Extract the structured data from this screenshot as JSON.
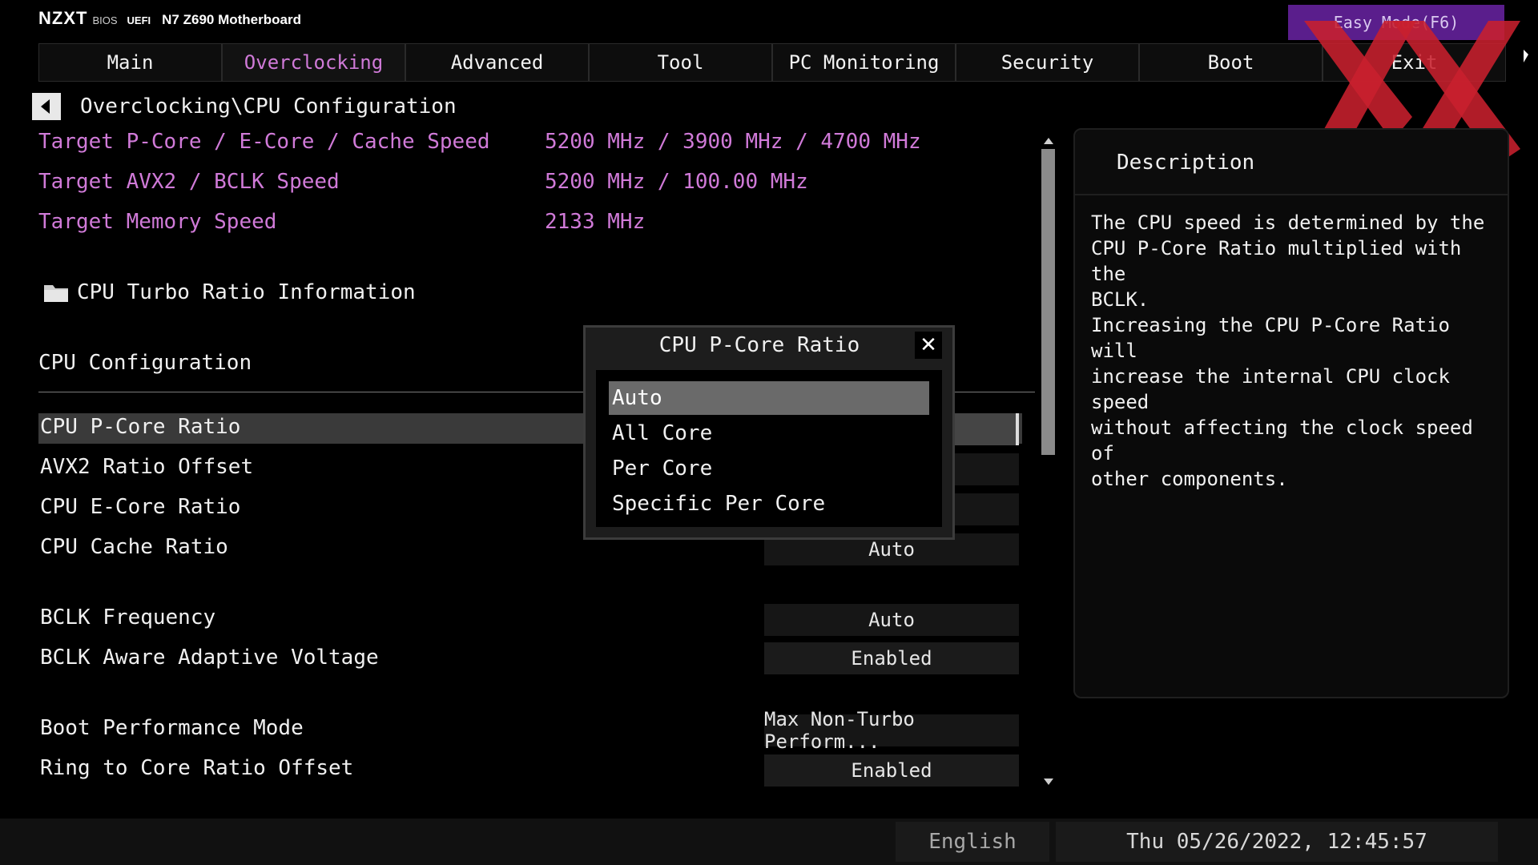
{
  "header": {
    "logo": "NZXT",
    "bios_label": "BIOS",
    "uefi_label": "UEFI",
    "model": "N7 Z690 Motherboard",
    "easy_mode": "Easy Mode(F6)"
  },
  "tabs": [
    {
      "label": "Main"
    },
    {
      "label": "Overclocking"
    },
    {
      "label": "Advanced"
    },
    {
      "label": "Tool"
    },
    {
      "label": "PC Monitoring"
    },
    {
      "label": "Security"
    },
    {
      "label": "Boot"
    },
    {
      "label": "Exit"
    }
  ],
  "active_tab": "Overclocking",
  "breadcrumb": "Overclocking\\CPU Configuration",
  "info": [
    {
      "label": "Target P-Core / E-Core / Cache Speed",
      "value": "5200 MHz / 3900 MHz / 4700 MHz"
    },
    {
      "label": "Target AVX2 / BCLK Speed",
      "value": "5200 MHz / 100.00 MHz"
    },
    {
      "label": "Target Memory Speed",
      "value": "2133 MHz"
    }
  ],
  "submenu": "CPU Turbo Ratio Information",
  "section_title": "CPU Configuration",
  "settings": [
    {
      "label": "CPU P-Core Ratio",
      "value": ""
    },
    {
      "label": "AVX2 Ratio Offset",
      "value": ""
    },
    {
      "label": "CPU E-Core Ratio",
      "value": ""
    },
    {
      "label": "CPU Cache  Ratio",
      "value": "Auto"
    },
    {
      "label": "BCLK Frequency",
      "value": "Auto"
    },
    {
      "label": "BCLK Aware Adaptive Voltage",
      "value": "Enabled"
    },
    {
      "label": "Boot Performance Mode",
      "value": "Max Non-Turbo Perform..."
    },
    {
      "label": "Ring to Core Ratio Offset",
      "value": "Enabled"
    }
  ],
  "dialog": {
    "title": "CPU P-Core Ratio",
    "close": "✕",
    "options": [
      "Auto",
      "All Core",
      "Per Core",
      "Specific Per Core"
    ],
    "selected": "Auto"
  },
  "description": {
    "title": "Description",
    "text": "The CPU speed is determined by the\nCPU P-Core Ratio multiplied with the\nBCLK.\nIncreasing the CPU P-Core Ratio will\nincrease the internal CPU clock speed\nwithout affecting the clock speed of\nother components."
  },
  "footer": {
    "language": "English",
    "datetime": "Thu 05/26/2022, 12:45:57"
  },
  "colors": {
    "accent_pink": "#d07ad8",
    "easy_mode_bg": "#5a1e8c",
    "watermark_red": "#c8202d"
  }
}
